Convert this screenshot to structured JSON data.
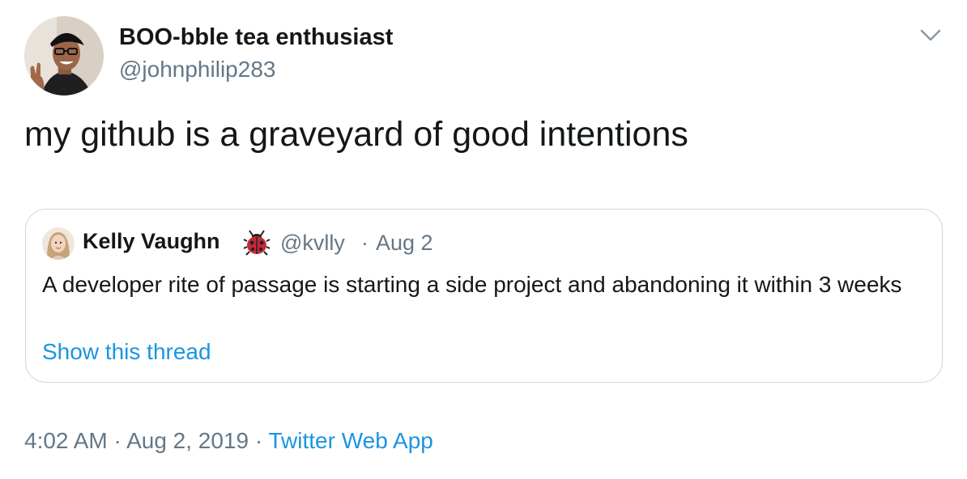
{
  "tweet": {
    "author_name": "BOO-bble tea enthusiast",
    "author_handle": "@johnphilip283",
    "text": "my github is a graveyard of good intentions",
    "caret_icon": "chevron-down-icon",
    "time": "4:02 AM",
    "separator": "·",
    "date": "Aug 2, 2019",
    "source": "Twitter Web App"
  },
  "quote": {
    "author_name": "Kelly Vaughn",
    "author_emoji": "ladybug-icon",
    "author_handle": "@kvlly",
    "separator": "·",
    "date": "Aug 2",
    "text": "A developer rite of passage is starting a side project and abandoning it within 3 weeks",
    "show_thread": "Show this thread"
  },
  "colors": {
    "text_primary": "#14171a",
    "text_secondary": "#657786",
    "link": "#1b95e0",
    "border": "#ccd6dd"
  }
}
